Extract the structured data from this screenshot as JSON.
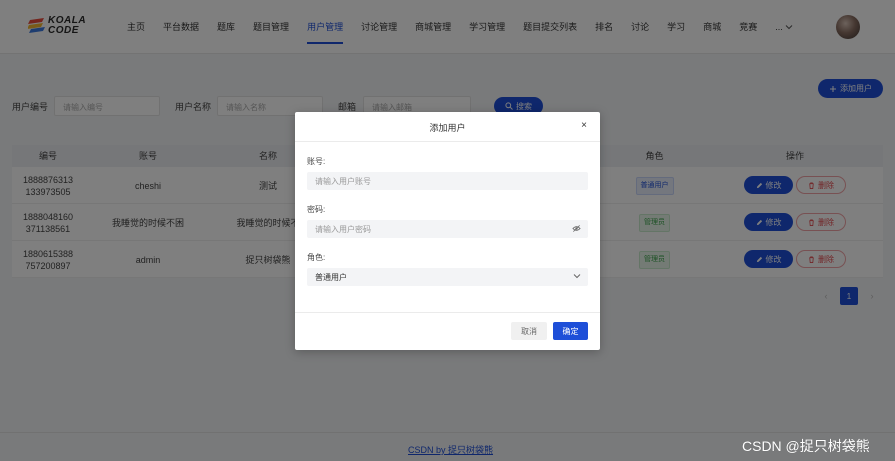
{
  "brand": {
    "line1": "KOALA",
    "line2": "CODE"
  },
  "nav": {
    "items": [
      "主页",
      "平台数据",
      "题库",
      "题目管理",
      "用户管理",
      "讨论管理",
      "商城管理",
      "学习管理",
      "题目提交列表",
      "排名",
      "讨论",
      "学习",
      "商城",
      "竞赛"
    ],
    "active": "用户管理",
    "more_label": "...",
    "more_icon": "chevron-down-icon"
  },
  "search": {
    "user_id_label": "用户编号",
    "user_id_placeholder": "请输入编号",
    "username_label": "用户名称",
    "username_placeholder": "请输入名称",
    "email_label": "邮箱",
    "email_placeholder": "请输入邮箱",
    "search_button": "搜索",
    "add_button": "添加用户"
  },
  "table": {
    "headers": [
      "编号",
      "账号",
      "名称",
      "角色",
      "操作"
    ],
    "rows": [
      {
        "id": "1888876313 133973505",
        "account": "cheshi",
        "name": "测试",
        "role": "普通用户",
        "role_type": "user"
      },
      {
        "id": "1888048160 371138561",
        "account": "我睡觉的时候不困",
        "name": "我睡觉的时候不",
        "role": "管理员",
        "role_type": "admin"
      },
      {
        "id": "1880615388 757200897",
        "account": "admin",
        "name": "捉只树袋熊",
        "role": "管理员",
        "role_type": "admin"
      }
    ],
    "edit_label": "修改",
    "delete_label": "删除"
  },
  "pagination": {
    "prev": "‹",
    "current": "1",
    "next": "›"
  },
  "footer": {
    "link": "CSDN by 捉只树袋熊"
  },
  "watermark": "CSDN @捉只树袋熊",
  "modal": {
    "title": "添加用户",
    "close": "×",
    "account_label": "账号:",
    "account_placeholder": "请输入用户账号",
    "password_label": "密码:",
    "password_placeholder": "请输入用户密码",
    "role_label": "角色:",
    "role_value": "普通用户",
    "cancel": "取消",
    "confirm": "确定"
  },
  "colors": {
    "accent": "#1e4fd8",
    "danger": "#e5484d",
    "success": "#3aa34a"
  }
}
